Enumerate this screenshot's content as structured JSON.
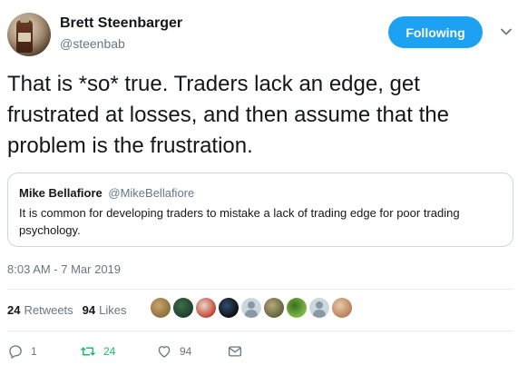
{
  "author": {
    "name": "Brett Steenbarger",
    "handle": "@steenbab"
  },
  "follow_button": {
    "label": "Following"
  },
  "tweet": {
    "text": "That is *so* true.  Traders lack an edge, get frustrated at losses, and then assume that the problem is the frustration."
  },
  "quoted_tweet": {
    "name": "Mike Bellafiore",
    "handle": "@MikeBellafiore",
    "text": "It is common for developing traders to mistake a lack of trading edge for poor trading psychology."
  },
  "timestamp": "8:03 AM - 7 Mar 2019",
  "stats": {
    "retweets_count": "24",
    "retweets_label": "Retweets",
    "likes_count": "94",
    "likes_label": "Likes"
  },
  "likers": [
    {
      "colors": [
        "#8a6a3c",
        "#c9a66b"
      ]
    },
    {
      "colors": [
        "#1b3b2a",
        "#3c6f4a"
      ]
    },
    {
      "colors": [
        "#c0392b",
        "#e8d6c8"
      ]
    },
    {
      "colors": [
        "#0b0b0b",
        "#2f4f6f"
      ]
    },
    {
      "colors": [
        "#ccd6dd",
        "#8899a6"
      ],
      "default": true
    },
    {
      "colors": [
        "#5c5e3b",
        "#b7a97a"
      ]
    },
    {
      "colors": [
        "#7fbf4d",
        "#3d6e1e"
      ]
    },
    {
      "colors": [
        "#ccd6dd",
        "#8899a6"
      ],
      "default": true
    },
    {
      "colors": [
        "#b57b56",
        "#e8c9a8"
      ]
    }
  ],
  "actions": {
    "reply_count": "1",
    "retweet_count": "24",
    "like_count": "94"
  },
  "colors": {
    "accent": "#1da1f2",
    "retweet": "#17bf63",
    "secondary_text": "#657786"
  },
  "icons": {
    "caret": "chevron-down-icon",
    "reply": "reply-icon",
    "retweet": "retweet-icon",
    "like": "heart-icon",
    "dm": "envelope-icon"
  }
}
